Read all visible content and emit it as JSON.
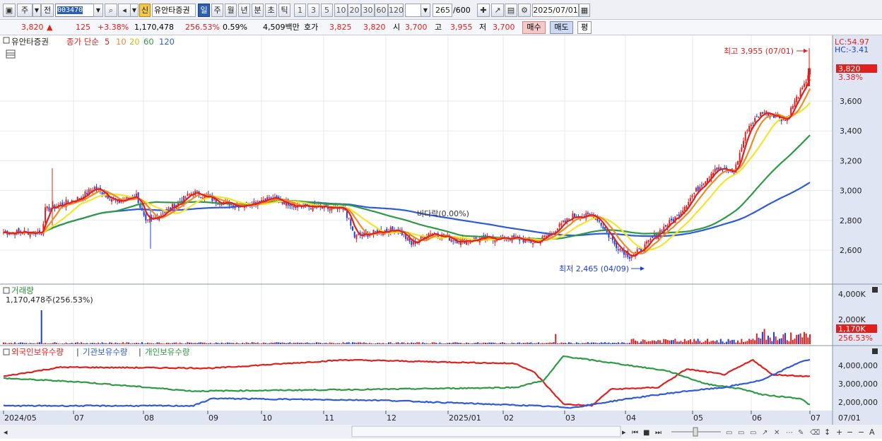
{
  "toolbar": {
    "period_select": "주",
    "prev_label": "전",
    "stock_code": "003470",
    "new_badge": "신",
    "stock_name": "유안타증권",
    "period_tabs": [
      "일",
      "주",
      "월",
      "년",
      "분",
      "초",
      "틱"
    ],
    "interval_buttons": [
      "1",
      "3",
      "5",
      "10",
      "20",
      "30",
      "60",
      "120"
    ],
    "count_value": "265",
    "count_total": "/600",
    "date_value": "2025/07/01"
  },
  "quote": {
    "price": "3,820",
    "direction": "▲",
    "change": "125",
    "change_pct": "+3.38%",
    "volume": "1,170,478",
    "volume_ratio": "256.53%",
    "turnover": "0.59%",
    "amount": "4,509백만",
    "label_hoga": "호가",
    "ask": "3,825",
    "bid": "3,820",
    "label_open": "시",
    "open": "3,700",
    "label_high": "고",
    "high": "3,955",
    "label_low": "저",
    "low": "3,700",
    "buy_label": "매수",
    "sell_label": "매도",
    "eval_label": "평"
  },
  "price_panel": {
    "title": "유안타증권",
    "ma_title": "종가 단순",
    "ma_periods": [
      "5",
      "10",
      "20",
      "60",
      "120"
    ],
    "lc_label": "LC:54.97",
    "hc_label": "HC:-3.41",
    "high_note": "최고 3,955 (07/01)",
    "low_note": "최저 2,465 (04/09)",
    "mid_note": "비다락(0.00%)",
    "current_price_tag": "3,820",
    "current_pct_tag": "3.38%",
    "y_ticks": [
      "3,600",
      "3,400",
      "3,200",
      "3,000",
      "2,800",
      "2,600"
    ]
  },
  "volume_panel": {
    "title": "거래량",
    "value_note": "1,170,478주(256.53%)",
    "y_ticks": [
      "4,000K",
      "2,000K"
    ],
    "current_tag": "1,170K",
    "current_pct": "256.53%"
  },
  "holding_panel": {
    "series_labels": [
      "외국인보유수량",
      "기관보유수량",
      "개인보유수량"
    ],
    "y_ticks": [
      "4,000,000",
      "3,000,000",
      "2,000,000"
    ]
  },
  "x_axis": {
    "labels": [
      "2024/05",
      "07",
      "08",
      "09",
      "10",
      "11",
      "12",
      "2025/01",
      "02",
      "03",
      "04",
      "05",
      "06",
      "07"
    ],
    "right_label": "07/01"
  },
  "colors": {
    "up": "#e0201f",
    "down": "#1c3fd8",
    "ma5": "#e0201f",
    "ma10": "#f08a24",
    "ma20": "#f5e52a",
    "ma60": "#2e9a45",
    "ma120": "#2f5ad8",
    "panel_bg": "#ffffff",
    "axis_bg": "#dfe5f2"
  }
}
